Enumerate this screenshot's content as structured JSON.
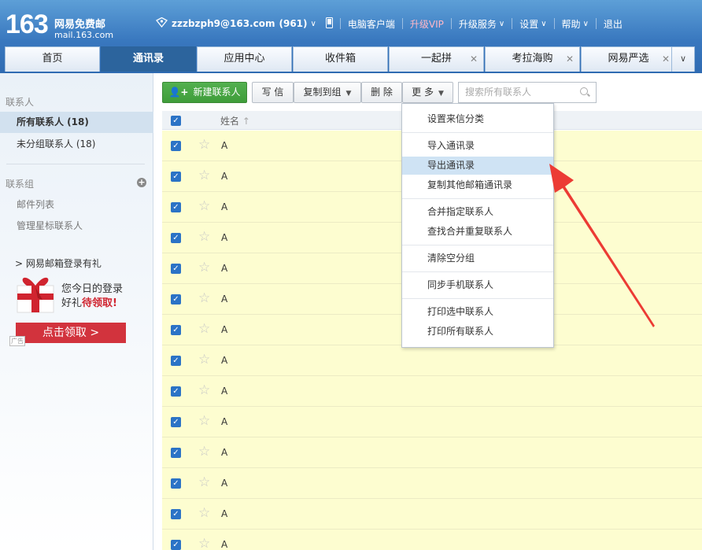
{
  "logo": {
    "number": "163",
    "name": "网易免费邮",
    "domain": "mail.163.com"
  },
  "topbar": {
    "account": "zzzbzph9@163.com",
    "count": "(961)",
    "client": "电脑客户端",
    "vip": "升级VIP",
    "upgrade": "升级服务",
    "settings": "设置",
    "help": "帮助",
    "logout": "退出"
  },
  "tabs": [
    {
      "label": "首页"
    },
    {
      "label": "通讯录"
    },
    {
      "label": "应用中心"
    },
    {
      "label": "收件箱"
    },
    {
      "label": "一起拼"
    },
    {
      "label": "考拉海购"
    },
    {
      "label": "网易严选"
    }
  ],
  "sidebar": {
    "contacts_heading": "联系人",
    "all_contacts": "所有联系人 (18)",
    "ungrouped": "未分组联系人 (18)",
    "groups_heading": "联系组",
    "mail_list": "邮件列表",
    "manage_starred": "管理星标联系人",
    "promo_title": "网易邮箱登录有礼",
    "promo_line1": "您今日的登录",
    "promo_line2a": "好礼",
    "promo_line2b": "待领取!",
    "promo_button": "点击领取 >",
    "ad_tag": "广告"
  },
  "toolbar": {
    "new_contact": "新建联系人",
    "write": "写 信",
    "copy_to_group": "复制到组",
    "delete": "删 除",
    "more": "更 多",
    "search_placeholder": "搜索所有联系人"
  },
  "table": {
    "name_header": "姓名",
    "rows": [
      "A",
      "A",
      "A",
      "A",
      "A",
      "A",
      "A",
      "A",
      "A",
      "A",
      "A",
      "A",
      "A",
      "A"
    ]
  },
  "more_menu": {
    "items": [
      "设置来信分类",
      "导入通讯录",
      "导出通讯录",
      "复制其他邮箱通讯录",
      "合并指定联系人",
      "查找合并重复联系人",
      "清除空分组",
      "同步手机联系人",
      "打印选中联系人",
      "打印所有联系人"
    ],
    "highlighted": "导出通讯录"
  },
  "colors": {
    "header": "#3978bf",
    "accent_green": "#3f9d3a",
    "row_bg": "#fdfdd0",
    "menu_highlight": "#cfe3f4",
    "annotation_arrow": "#ec3b34"
  }
}
